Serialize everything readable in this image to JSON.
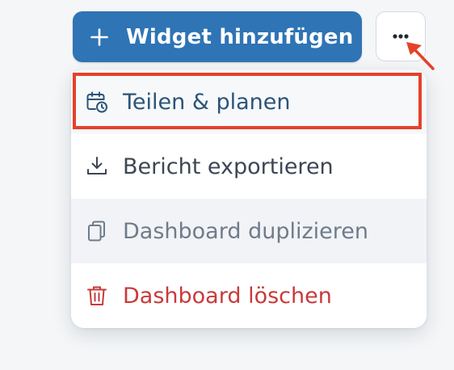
{
  "toolbar": {
    "add_widget_label": "Widget hinzufügen",
    "add_widget_icon": "plus-icon",
    "more_icon": "more-horizontal-icon",
    "primary_color": "#2f74b5"
  },
  "menu": {
    "items": [
      {
        "label": "Teilen & planen",
        "icon": "calendar-clock-icon",
        "state": "highlighted"
      },
      {
        "label": "Bericht exportieren",
        "icon": "download-icon",
        "state": "normal"
      },
      {
        "label": "Dashboard duplizieren",
        "icon": "copy-icon",
        "state": "disabled"
      },
      {
        "label": "Dashboard löschen",
        "icon": "trash-icon",
        "state": "destructive"
      }
    ]
  },
  "annotation": {
    "highlight_color": "#e5412a",
    "arrow_color": "#e5412a"
  }
}
